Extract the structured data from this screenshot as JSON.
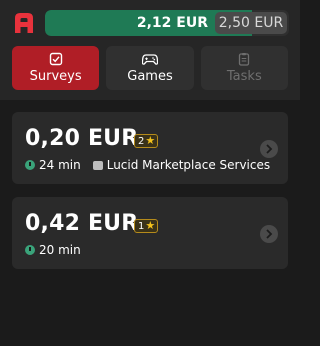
{
  "header": {
    "logo_icon": "app-logo-icon",
    "brand_color": "#e8323c",
    "balance": {
      "current": "2,12 EUR",
      "target": "2,50 EUR",
      "progress": 0.848,
      "fill_color": "#1f7a55"
    }
  },
  "tabs": [
    {
      "label": "Surveys",
      "icon": "checkbox-icon",
      "active": true
    },
    {
      "label": "Games",
      "icon": "gamepad-icon",
      "active": false
    },
    {
      "label": "Tasks",
      "icon": "clipboard-icon",
      "active": false,
      "disabled": true
    }
  ],
  "offers": [
    {
      "amount": "0,20 EUR",
      "stars": "2",
      "duration": "24 min",
      "provider": "Lucid Marketplace Services"
    },
    {
      "amount": "0,42 EUR",
      "stars": "1",
      "duration": "20 min"
    }
  ]
}
